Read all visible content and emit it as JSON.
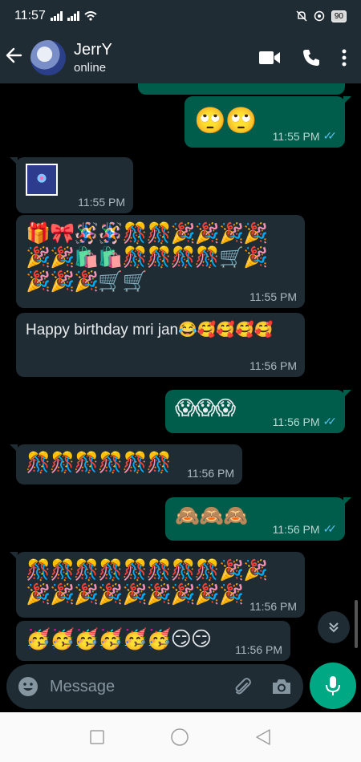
{
  "status_bar": {
    "time": "11:57",
    "battery": "90"
  },
  "header": {
    "contact_name": "JerrY",
    "contact_status": "online"
  },
  "messages": [
    {
      "dir": "out",
      "content": "🙄🙄",
      "time": "11:55 PM",
      "ticks": "✓✓"
    },
    {
      "dir": "in",
      "content": "",
      "time": "11:55 PM"
    },
    {
      "dir": "in",
      "content": "🎁🎀🪅🪅🎊🎊🎉🎉🎉🎉🎉🎉🛍️🛍️🎊🎊🎊🎊🛒🎉🎉🎉🎉🛒🛒",
      "time": "11:55 PM"
    },
    {
      "dir": "in",
      "text": "Happy birthday mri jan😂🥰🥰🥰🥰",
      "time": "11:56 PM"
    },
    {
      "dir": "out",
      "content": "😱😱😱",
      "time": "11:56 PM",
      "ticks": "✓✓"
    },
    {
      "dir": "in",
      "content": "🎊🎊🎊🎊🎊🎊",
      "time": "11:56 PM"
    },
    {
      "dir": "out",
      "content": "🙈🙈🙈",
      "time": "11:56 PM",
      "ticks": "✓✓"
    },
    {
      "dir": "in",
      "content": "🎊🎊🎊🎊🎊🎊🎊🎊🎉🎉🎉🎉🎉🎉🎉🎉🎉🎉🎉",
      "time": "11:56 PM"
    },
    {
      "dir": "in",
      "content": "🥳🥳🥳🥳🥳🥳😏😏",
      "time": "11:56 PM"
    }
  ],
  "input": {
    "placeholder": "Message"
  },
  "icons": {
    "back": "arrow-left-icon",
    "video": "video-camera-icon",
    "call": "phone-icon",
    "menu": "more-vert-icon",
    "emoji": "emoji-icon",
    "attach": "paperclip-icon",
    "camera": "camera-icon",
    "mic": "microphone-icon",
    "scroll": "double-chevron-down-icon",
    "nav_recent": "square-icon",
    "nav_home": "circle-icon",
    "nav_back": "triangle-back-icon"
  },
  "colors": {
    "header_bg": "#1f2c34",
    "incoming_bg": "#1f2c34",
    "outgoing_bg": "#005c4b",
    "accent": "#00a884",
    "read_ticks": "#53bdeb"
  }
}
